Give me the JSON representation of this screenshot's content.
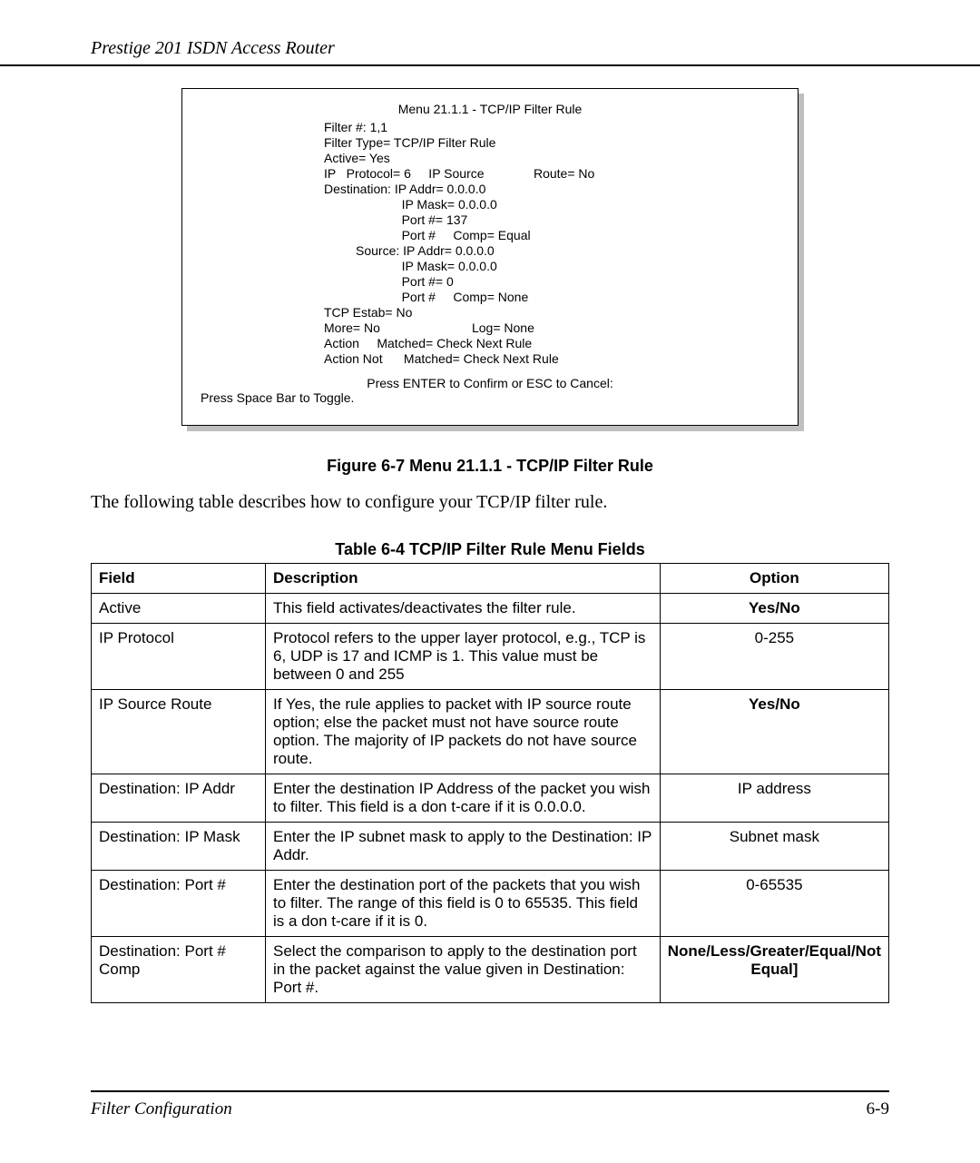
{
  "header": "Prestige 201 ISDN Access Router",
  "menu": {
    "title": "Menu 21.1.1 - TCP/IP Filter Rule",
    "body": "Filter #: 1,1\nFilter Type= TCP/IP Filter Rule\nActive= Yes\nIP   Protocol= 6     IP Source              Route= No\nDestination: IP Addr= 0.0.0.0\n                      IP Mask= 0.0.0.0\n                      Port #= 137\n                      Port #     Comp= Equal\n         Source: IP Addr= 0.0.0.0\n                      IP Mask= 0.0.0.0\n                      Port #= 0\n                      Port #     Comp= None\nTCP Estab= No\nMore= No                          Log= None\nAction     Matched= Check Next Rule\nAction Not      Matched= Check Next Rule",
    "foot1": "Press ENTER to Confirm or ESC to Cancel:",
    "foot2": "Press Space Bar to Toggle."
  },
  "figure_caption": "Figure 6-7 Menu 21.1.1 - TCP/IP Filter Rule",
  "body_text": "The following table describes how to configure your TCP/IP filter rule.",
  "table_caption": "Table 6-4 TCP/IP Filter Rule Menu Fields",
  "table": {
    "headers": {
      "field": "Field",
      "description": "Description",
      "option": "Option"
    },
    "rows": [
      {
        "field": "Active",
        "description": "This field activates/deactivates the filter rule.",
        "option": "Yes/No",
        "option_bold": true
      },
      {
        "field": "IP Protocol",
        "description": "Protocol refers to the upper layer protocol, e.g., TCP is 6, UDP is 17 and ICMP is 1.  This value must be between 0 and 255",
        "option": "0-255",
        "option_bold": false
      },
      {
        "field": "IP Source Route",
        "description": "If Yes, the rule applies to packet with IP source route option; else the packet must not have source route option. The majority of IP packets do not have source route.",
        "option": "Yes/No",
        "option_bold": true
      },
      {
        "field": "Destination: IP Addr",
        "description": "Enter the destination IP Address of the packet you wish to filter.  This field is a don t-care if it is 0.0.0.0.",
        "option": "IP address",
        "option_bold": false
      },
      {
        "field": "Destination: IP Mask",
        "description": "Enter the IP subnet mask to apply to the Destination: IP Addr.",
        "option": "Subnet mask",
        "option_bold": false
      },
      {
        "field": "Destination: Port #",
        "description": "Enter the destination port of the packets that you wish to filter. The range of this field is 0 to 65535.  This field is a don t-care if it is 0.",
        "option": "0-65535",
        "option_bold": false
      },
      {
        "field": "Destination: Port # Comp",
        "description": "Select the comparison to apply to the destination port in the packet against the value given in Destination: Port #.",
        "option": "None/Less/Greater/Equal/Not Equal]",
        "option_bold": true
      }
    ]
  },
  "footer": {
    "left": "Filter Configuration",
    "right": "6-9"
  }
}
